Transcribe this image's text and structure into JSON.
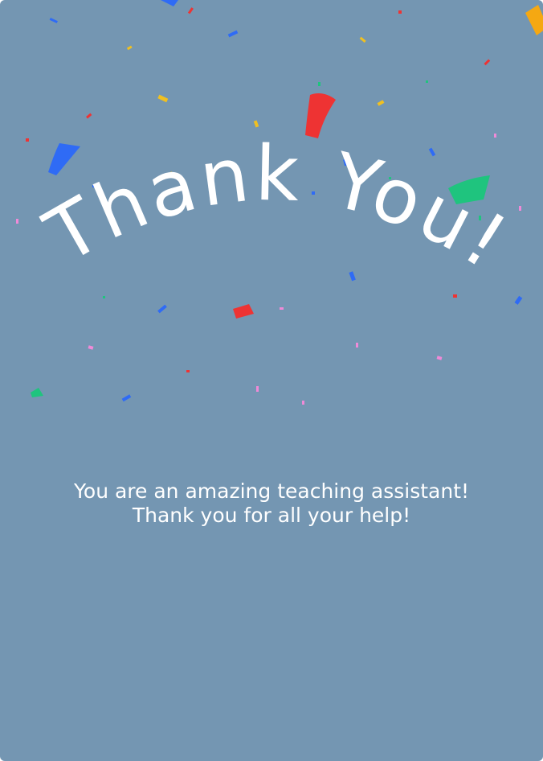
{
  "card": {
    "background": "#7496b2",
    "headline": "Thank You!",
    "message_line_1": "You are an amazing teaching assistant!",
    "message_line_2": "Thank you for all your help!"
  },
  "confetti": {
    "icon": "confetti-icon",
    "colors": [
      "#2f6bf5",
      "#f0c020",
      "#ee3333",
      "#1fc47e",
      "#f08ad8",
      "#f5a812"
    ]
  }
}
